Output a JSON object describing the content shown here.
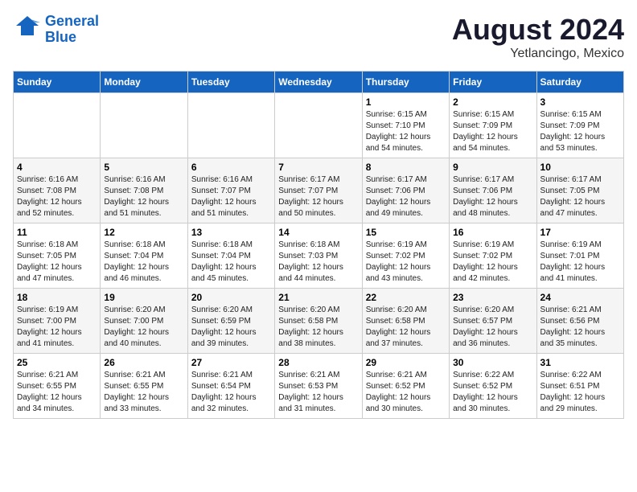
{
  "header": {
    "logo_line1": "General",
    "logo_line2": "Blue",
    "month": "August 2024",
    "location": "Yetlancingo, Mexico"
  },
  "weekdays": [
    "Sunday",
    "Monday",
    "Tuesday",
    "Wednesday",
    "Thursday",
    "Friday",
    "Saturday"
  ],
  "weeks": [
    [
      {
        "day": "",
        "info": ""
      },
      {
        "day": "",
        "info": ""
      },
      {
        "day": "",
        "info": ""
      },
      {
        "day": "",
        "info": ""
      },
      {
        "day": "1",
        "info": "Sunrise: 6:15 AM\nSunset: 7:10 PM\nDaylight: 12 hours\nand 54 minutes."
      },
      {
        "day": "2",
        "info": "Sunrise: 6:15 AM\nSunset: 7:09 PM\nDaylight: 12 hours\nand 54 minutes."
      },
      {
        "day": "3",
        "info": "Sunrise: 6:15 AM\nSunset: 7:09 PM\nDaylight: 12 hours\nand 53 minutes."
      }
    ],
    [
      {
        "day": "4",
        "info": "Sunrise: 6:16 AM\nSunset: 7:08 PM\nDaylight: 12 hours\nand 52 minutes."
      },
      {
        "day": "5",
        "info": "Sunrise: 6:16 AM\nSunset: 7:08 PM\nDaylight: 12 hours\nand 51 minutes."
      },
      {
        "day": "6",
        "info": "Sunrise: 6:16 AM\nSunset: 7:07 PM\nDaylight: 12 hours\nand 51 minutes."
      },
      {
        "day": "7",
        "info": "Sunrise: 6:17 AM\nSunset: 7:07 PM\nDaylight: 12 hours\nand 50 minutes."
      },
      {
        "day": "8",
        "info": "Sunrise: 6:17 AM\nSunset: 7:06 PM\nDaylight: 12 hours\nand 49 minutes."
      },
      {
        "day": "9",
        "info": "Sunrise: 6:17 AM\nSunset: 7:06 PM\nDaylight: 12 hours\nand 48 minutes."
      },
      {
        "day": "10",
        "info": "Sunrise: 6:17 AM\nSunset: 7:05 PM\nDaylight: 12 hours\nand 47 minutes."
      }
    ],
    [
      {
        "day": "11",
        "info": "Sunrise: 6:18 AM\nSunset: 7:05 PM\nDaylight: 12 hours\nand 47 minutes."
      },
      {
        "day": "12",
        "info": "Sunrise: 6:18 AM\nSunset: 7:04 PM\nDaylight: 12 hours\nand 46 minutes."
      },
      {
        "day": "13",
        "info": "Sunrise: 6:18 AM\nSunset: 7:04 PM\nDaylight: 12 hours\nand 45 minutes."
      },
      {
        "day": "14",
        "info": "Sunrise: 6:18 AM\nSunset: 7:03 PM\nDaylight: 12 hours\nand 44 minutes."
      },
      {
        "day": "15",
        "info": "Sunrise: 6:19 AM\nSunset: 7:02 PM\nDaylight: 12 hours\nand 43 minutes."
      },
      {
        "day": "16",
        "info": "Sunrise: 6:19 AM\nSunset: 7:02 PM\nDaylight: 12 hours\nand 42 minutes."
      },
      {
        "day": "17",
        "info": "Sunrise: 6:19 AM\nSunset: 7:01 PM\nDaylight: 12 hours\nand 41 minutes."
      }
    ],
    [
      {
        "day": "18",
        "info": "Sunrise: 6:19 AM\nSunset: 7:00 PM\nDaylight: 12 hours\nand 41 minutes."
      },
      {
        "day": "19",
        "info": "Sunrise: 6:20 AM\nSunset: 7:00 PM\nDaylight: 12 hours\nand 40 minutes."
      },
      {
        "day": "20",
        "info": "Sunrise: 6:20 AM\nSunset: 6:59 PM\nDaylight: 12 hours\nand 39 minutes."
      },
      {
        "day": "21",
        "info": "Sunrise: 6:20 AM\nSunset: 6:58 PM\nDaylight: 12 hours\nand 38 minutes."
      },
      {
        "day": "22",
        "info": "Sunrise: 6:20 AM\nSunset: 6:58 PM\nDaylight: 12 hours\nand 37 minutes."
      },
      {
        "day": "23",
        "info": "Sunrise: 6:20 AM\nSunset: 6:57 PM\nDaylight: 12 hours\nand 36 minutes."
      },
      {
        "day": "24",
        "info": "Sunrise: 6:21 AM\nSunset: 6:56 PM\nDaylight: 12 hours\nand 35 minutes."
      }
    ],
    [
      {
        "day": "25",
        "info": "Sunrise: 6:21 AM\nSunset: 6:55 PM\nDaylight: 12 hours\nand 34 minutes."
      },
      {
        "day": "26",
        "info": "Sunrise: 6:21 AM\nSunset: 6:55 PM\nDaylight: 12 hours\nand 33 minutes."
      },
      {
        "day": "27",
        "info": "Sunrise: 6:21 AM\nSunset: 6:54 PM\nDaylight: 12 hours\nand 32 minutes."
      },
      {
        "day": "28",
        "info": "Sunrise: 6:21 AM\nSunset: 6:53 PM\nDaylight: 12 hours\nand 31 minutes."
      },
      {
        "day": "29",
        "info": "Sunrise: 6:21 AM\nSunset: 6:52 PM\nDaylight: 12 hours\nand 30 minutes."
      },
      {
        "day": "30",
        "info": "Sunrise: 6:22 AM\nSunset: 6:52 PM\nDaylight: 12 hours\nand 30 minutes."
      },
      {
        "day": "31",
        "info": "Sunrise: 6:22 AM\nSunset: 6:51 PM\nDaylight: 12 hours\nand 29 minutes."
      }
    ]
  ]
}
